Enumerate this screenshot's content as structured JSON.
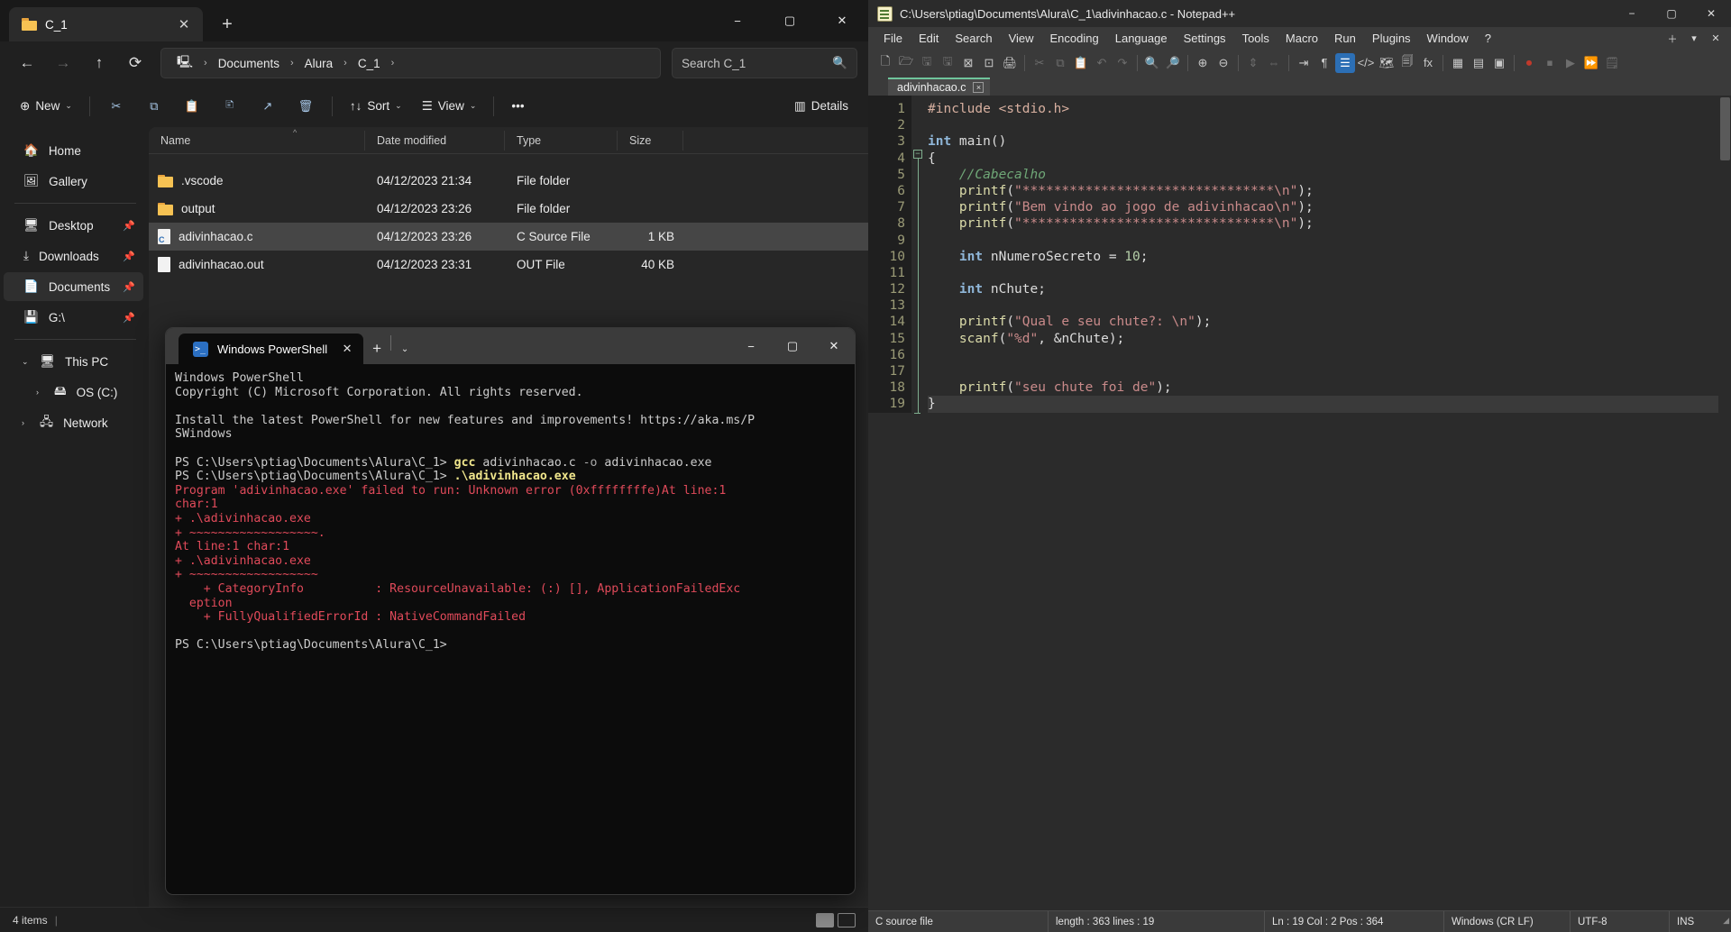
{
  "explorer": {
    "tab": {
      "title": "C_1",
      "close_label": "✕",
      "newtab_label": "+"
    },
    "window_controls": {
      "minimize": "−",
      "maximize": "▢",
      "close": "✕"
    },
    "nav": {
      "back": "←",
      "forward": "→",
      "up": "↑",
      "refresh": "⟳",
      "breadcrumbs": [
        "Documents",
        "Alura",
        "C_1"
      ],
      "sep": "›",
      "search_placeholder": "Search C_1",
      "search_icon": "search-icon"
    },
    "toolbar": {
      "new_label": "New",
      "sort_label": "Sort",
      "view_label": "View",
      "more_label": "•••",
      "details_label": "Details",
      "icons": [
        "cut-icon",
        "copy-icon",
        "paste-icon",
        "rename-icon",
        "share-icon",
        "delete-icon"
      ]
    },
    "sidebar": {
      "group1": [
        {
          "label": "Home",
          "icon": "home-icon"
        },
        {
          "label": "Gallery",
          "icon": "gallery-icon"
        }
      ],
      "group2": [
        {
          "label": "Desktop",
          "icon": "desktop-icon",
          "pinned": true
        },
        {
          "label": "Downloads",
          "icon": "downloads-icon",
          "pinned": true
        },
        {
          "label": "Documents",
          "icon": "documents-icon",
          "pinned": true,
          "selected": true
        },
        {
          "label": "G:\\",
          "icon": "drive-icon",
          "pinned": true
        }
      ],
      "group3": [
        {
          "label": "This PC",
          "icon": "pc-icon",
          "expanded": true
        },
        {
          "label": "OS (C:)",
          "icon": "disk-icon",
          "indent": true
        },
        {
          "label": "Network",
          "icon": "network-icon"
        }
      ]
    },
    "columns": [
      "Name",
      "Date modified",
      "Type",
      "Size"
    ],
    "rows": [
      {
        "name": ".vscode",
        "date": "04/12/2023 21:34",
        "type": "File folder",
        "size": "",
        "icon": "folder-icon",
        "selected": false
      },
      {
        "name": "output",
        "date": "04/12/2023 23:26",
        "type": "File folder",
        "size": "",
        "icon": "folder-icon",
        "selected": false
      },
      {
        "name": "adivinhacao.c",
        "date": "04/12/2023 23:26",
        "type": "C Source File",
        "size": "1 KB",
        "icon": "c-file-icon",
        "selected": true
      },
      {
        "name": "adivinhacao.out",
        "date": "04/12/2023 23:31",
        "type": "OUT File",
        "size": "40 KB",
        "icon": "plain-file-icon",
        "selected": false
      }
    ],
    "status": {
      "item_count": "4 items",
      "layout_icons": [
        "details-view-icon",
        "tiles-view-icon"
      ]
    }
  },
  "powershell": {
    "tab_title": "Windows PowerShell",
    "tab_close": "✕",
    "new_tab": "+",
    "dropdown": "⌄",
    "window_controls": {
      "minimize": "−",
      "maximize": "▢",
      "close": "✕"
    },
    "lines": [
      {
        "text": "Windows PowerShell",
        "cls": ""
      },
      {
        "text": "Copyright (C) Microsoft Corporation. All rights reserved.",
        "cls": ""
      },
      {
        "text": "",
        "cls": ""
      },
      {
        "text": "Install the latest PowerShell for new features and improvements! https://aka.ms/P",
        "cls": ""
      },
      {
        "text": "SWindows",
        "cls": ""
      },
      {
        "text": "",
        "cls": ""
      },
      {
        "text": "PS C:\\Users\\ptiag\\Documents\\Alura\\C_1> ",
        "cls": "",
        "cmd": "gcc",
        "rest": " adivinhacao.c ",
        "param": "-o",
        "rest2": " adivinhacao.exe"
      },
      {
        "text": "PS C:\\Users\\ptiag\\Documents\\Alura\\C_1> ",
        "cls": "",
        "cmd": ".\\adivinhacao.exe"
      },
      {
        "text": "Program 'adivinhacao.exe' failed to run: Unknown error (0xffffffffe)At line:1",
        "cls": "ps-err"
      },
      {
        "text": "char:1",
        "cls": "ps-err"
      },
      {
        "text": "+ .\\adivinhacao.exe",
        "cls": "ps-err"
      },
      {
        "text": "+ ~~~~~~~~~~~~~~~~~~.",
        "cls": "ps-err"
      },
      {
        "text": "At line:1 char:1",
        "cls": "ps-err"
      },
      {
        "text": "+ .\\adivinhacao.exe",
        "cls": "ps-err"
      },
      {
        "text": "+ ~~~~~~~~~~~~~~~~~~",
        "cls": "ps-err"
      },
      {
        "text": "    + CategoryInfo          : ResourceUnavailable: (:) [], ApplicationFailedExc",
        "cls": "ps-err"
      },
      {
        "text": "  eption",
        "cls": "ps-err"
      },
      {
        "text": "    + FullyQualifiedErrorId : NativeCommandFailed",
        "cls": "ps-err"
      },
      {
        "text": "",
        "cls": ""
      },
      {
        "text": "PS C:\\Users\\ptiag\\Documents\\Alura\\C_1>",
        "cls": ""
      }
    ]
  },
  "notepadpp": {
    "title": "C:\\Users\\ptiag\\Documents\\Alura\\C_1\\adivinhacao.c - Notepad++",
    "window_controls": {
      "minimize": "−",
      "maximize": "▢",
      "close": "✕"
    },
    "menus": [
      "File",
      "Edit",
      "Search",
      "View",
      "Encoding",
      "Language",
      "Settings",
      "Tools",
      "Macro",
      "Run",
      "Plugins",
      "Window",
      "?"
    ],
    "menu_right": [
      "＋",
      "▾",
      "✕"
    ],
    "doc_tab": {
      "label": "adivinhacao.c",
      "close": "×"
    },
    "toolbar_icons": [
      "new-file-icon",
      "open-file-icon",
      "save-icon",
      "save-all-icon",
      "close-icon",
      "close-all-icon",
      "print-icon",
      "cut-icon",
      "copy-icon",
      "paste-icon",
      "undo-icon",
      "redo-icon",
      "find-icon",
      "replace-icon",
      "zoom-in-icon",
      "zoom-out-icon",
      "sync-scroll-v-icon",
      "sync-scroll-h-icon",
      "word-wrap-icon",
      "show-all-chars-icon",
      "indent-guide-icon",
      "show-html-icon",
      "document-map-icon",
      "function-list-icon",
      "folder-as-workspace-icon",
      "macro-record-icon",
      "macro-stop-icon",
      "macro-play-icon",
      "macro-play-multi-icon",
      "macro-save-icon"
    ],
    "code_lines": [
      {
        "n": 1,
        "tokens": [
          {
            "t": "#include ",
            "c": "k-pre"
          },
          {
            "t": "<stdio.h>",
            "c": "k-pre"
          }
        ]
      },
      {
        "n": 2,
        "tokens": []
      },
      {
        "n": 3,
        "tokens": [
          {
            "t": "int",
            "c": "k-key"
          },
          {
            "t": " main",
            "c": "k-op"
          },
          {
            "t": "()",
            "c": "k-punc"
          }
        ]
      },
      {
        "n": 4,
        "tokens": [
          {
            "t": "{",
            "c": "k-punc"
          }
        ]
      },
      {
        "n": 5,
        "tokens": [
          {
            "t": "    //Cabecalho",
            "c": "k-cmt"
          }
        ]
      },
      {
        "n": 6,
        "tokens": [
          {
            "t": "    ",
            "c": "k-op"
          },
          {
            "t": "printf",
            "c": "k-fn"
          },
          {
            "t": "(",
            "c": "k-punc"
          },
          {
            "t": "\"********************************\\n\"",
            "c": "k-str"
          },
          {
            "t": ");",
            "c": "k-punc"
          }
        ]
      },
      {
        "n": 7,
        "tokens": [
          {
            "t": "    ",
            "c": "k-op"
          },
          {
            "t": "printf",
            "c": "k-fn"
          },
          {
            "t": "(",
            "c": "k-punc"
          },
          {
            "t": "\"Bem vindo ao jogo de adivinhacao\\n\"",
            "c": "k-str"
          },
          {
            "t": ");",
            "c": "k-punc"
          }
        ]
      },
      {
        "n": 8,
        "tokens": [
          {
            "t": "    ",
            "c": "k-op"
          },
          {
            "t": "printf",
            "c": "k-fn"
          },
          {
            "t": "(",
            "c": "k-punc"
          },
          {
            "t": "\"********************************\\n\"",
            "c": "k-str"
          },
          {
            "t": ");",
            "c": "k-punc"
          }
        ]
      },
      {
        "n": 9,
        "tokens": []
      },
      {
        "n": 10,
        "tokens": [
          {
            "t": "    ",
            "c": "k-op"
          },
          {
            "t": "int",
            "c": "k-key"
          },
          {
            "t": " nNumeroSecreto ",
            "c": "k-op"
          },
          {
            "t": "=",
            "c": "k-punc"
          },
          {
            "t": " ",
            "c": "k-op"
          },
          {
            "t": "10",
            "c": "k-num"
          },
          {
            "t": ";",
            "c": "k-punc"
          }
        ]
      },
      {
        "n": 11,
        "tokens": []
      },
      {
        "n": 12,
        "tokens": [
          {
            "t": "    ",
            "c": "k-op"
          },
          {
            "t": "int",
            "c": "k-key"
          },
          {
            "t": " nChute",
            "c": "k-op"
          },
          {
            "t": ";",
            "c": "k-punc"
          }
        ]
      },
      {
        "n": 13,
        "tokens": []
      },
      {
        "n": 14,
        "tokens": [
          {
            "t": "    ",
            "c": "k-op"
          },
          {
            "t": "printf",
            "c": "k-fn"
          },
          {
            "t": "(",
            "c": "k-punc"
          },
          {
            "t": "\"Qual e seu chute?: \\n\"",
            "c": "k-str"
          },
          {
            "t": ");",
            "c": "k-punc"
          }
        ]
      },
      {
        "n": 15,
        "tokens": [
          {
            "t": "    ",
            "c": "k-op"
          },
          {
            "t": "scanf",
            "c": "k-fn"
          },
          {
            "t": "(",
            "c": "k-punc"
          },
          {
            "t": "\"%d\"",
            "c": "k-str"
          },
          {
            "t": ", ",
            "c": "k-punc"
          },
          {
            "t": "&",
            "c": "k-punc"
          },
          {
            "t": "nChute",
            "c": "k-op"
          },
          {
            "t": ");",
            "c": "k-punc"
          }
        ]
      },
      {
        "n": 16,
        "tokens": []
      },
      {
        "n": 17,
        "tokens": []
      },
      {
        "n": 18,
        "tokens": [
          {
            "t": "    ",
            "c": "k-op"
          },
          {
            "t": "printf",
            "c": "k-fn"
          },
          {
            "t": "(",
            "c": "k-punc"
          },
          {
            "t": "\"seu chute foi de\"",
            "c": "k-str"
          },
          {
            "t": ");",
            "c": "k-punc"
          }
        ]
      },
      {
        "n": 19,
        "tokens": [
          {
            "t": "}",
            "c": "k-punc"
          }
        ]
      }
    ],
    "status": {
      "doc_type": "C source file",
      "length_lines": "length : 363   lines : 19",
      "position": "Ln : 19   Col : 2   Pos : 364",
      "eol": "Windows (CR LF)",
      "encoding": "UTF-8",
      "insert_mode": "INS"
    }
  }
}
